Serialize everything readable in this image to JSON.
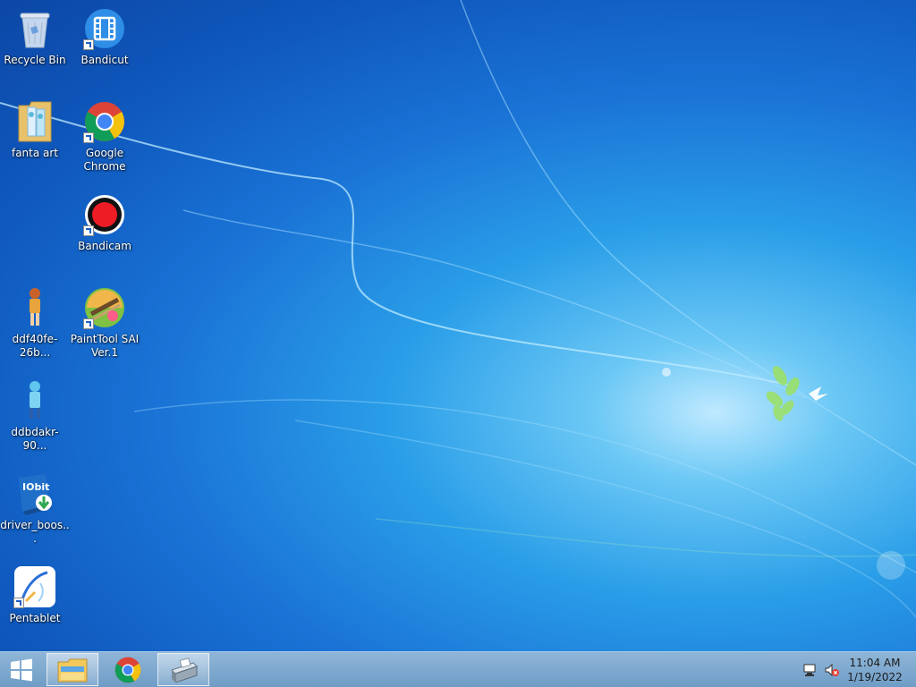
{
  "desktop_icons": [
    {
      "label": "Recycle Bin",
      "icon": "recycle-bin-icon",
      "shortcut": false
    },
    {
      "label": "Bandicut",
      "icon": "bandicut-icon",
      "shortcut": true
    },
    {
      "label": "fanta art",
      "icon": "folder-icon",
      "shortcut": false
    },
    {
      "label": "Google\nChrome",
      "icon": "chrome-icon",
      "shortcut": true
    },
    {
      "label": "Bandicam",
      "icon": "bandicam-icon",
      "shortcut": true
    },
    {
      "label": "ddf40fe-26b...",
      "icon": "image-file-icon",
      "shortcut": false
    },
    {
      "label": "PaintTool SAI\nVer.1",
      "icon": "painttool-sai-icon",
      "shortcut": true
    },
    {
      "label": "ddbdakr-90...",
      "icon": "image-file-icon",
      "shortcut": false
    },
    {
      "label": "driver_boos...",
      "icon": "iobit-installer-icon",
      "shortcut": false
    },
    {
      "label": "Pentablet",
      "icon": "pentablet-icon",
      "shortcut": true
    }
  ],
  "iobit_text": "IObit",
  "taskbar": {
    "start_icon": "windows-logo-icon",
    "pinned": [
      {
        "icon": "file-explorer-icon",
        "active": true
      },
      {
        "icon": "chrome-icon",
        "active": false
      },
      {
        "icon": "scanner-icon",
        "active": true
      }
    ],
    "tray": [
      "network-icon",
      "volume-muted-icon"
    ],
    "clock": {
      "time": "11:04 AM",
      "date": "1/19/2022"
    }
  },
  "colors": {
    "wallpaper_dark": "#0c47a6",
    "wallpaper_light": "#bfe9ff",
    "taskbar": "#7fa9cf"
  }
}
